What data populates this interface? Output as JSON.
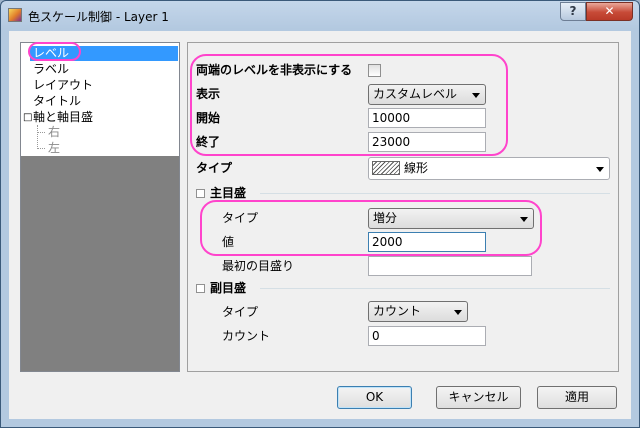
{
  "window": {
    "title": "色スケール制御 - Layer 1",
    "help_label": "?",
    "close_label": "✕"
  },
  "tree": {
    "items": [
      {
        "label": "レベル"
      },
      {
        "label": "ラベル"
      },
      {
        "label": "レイアウト"
      },
      {
        "label": "タイトル"
      },
      {
        "label": "軸と軸目盛"
      },
      {
        "label": "右"
      },
      {
        "label": "左"
      }
    ],
    "expander": "□"
  },
  "levels": {
    "hide_both_ends_label": "両端のレベルを非表示にする",
    "display_label": "表示",
    "display_value": "カスタムレベル",
    "start_label": "開始",
    "start_value": "10000",
    "end_label": "終了",
    "end_value": "23000",
    "type_label": "タイプ",
    "type_value": "線形"
  },
  "major_ticks": {
    "section_label": "主目盛",
    "toggle": "⊟",
    "type_label": "タイプ",
    "type_value": "増分",
    "value_label": "値",
    "value_value": "2000",
    "first_tick_label": "最初の目盛り",
    "first_tick_value": ""
  },
  "minor_ticks": {
    "section_label": "副目盛",
    "toggle": "⊟",
    "type_label": "タイプ",
    "type_value": "カウント",
    "count_label": "カウント",
    "count_value": "0"
  },
  "buttons": {
    "ok": "OK",
    "cancel": "キャンセル",
    "apply": "適用"
  },
  "colors": {
    "highlight": "#ff44cc",
    "selection": "#3399ff"
  }
}
